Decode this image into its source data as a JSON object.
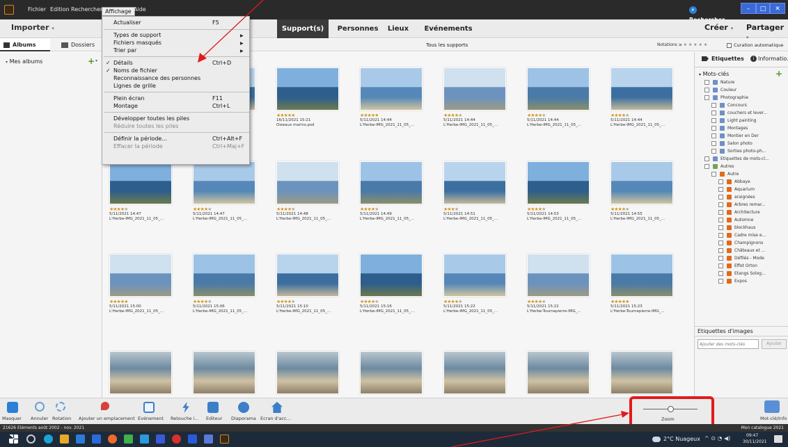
{
  "menubar": {
    "items": [
      "Fichier",
      "Edition",
      "Rechercher",
      "Affichage",
      "Aide"
    ],
    "search_label": "Rechercher",
    "window_buttons": [
      "–",
      "□",
      "✕"
    ]
  },
  "toolbar": {
    "import_label": "Importer",
    "tabs": [
      "Support(s)",
      "Personnes",
      "Lieux",
      "Evénements"
    ],
    "create_label": "Créer",
    "share_label": "Partager"
  },
  "subbar": {
    "albums_label": "Albums",
    "folders_label": "Dossiers",
    "title": "Tous les supports",
    "ratings_label": "Notations ≥",
    "auto_curation_label": "Curation automatique"
  },
  "sidebar": {
    "my_albums_label": "Mes albums"
  },
  "dropdown_menu": {
    "items": [
      {
        "label": "Actualiser",
        "shortcut": "F5"
      },
      {
        "label": "Types de support"
      },
      {
        "label": "Fichiers masqués"
      },
      {
        "label": "Trier par"
      },
      {
        "label": "Détails",
        "shortcut": "Ctrl+D"
      },
      {
        "label": "Noms de fichier"
      },
      {
        "label": "Reconnaissance des personnes"
      },
      {
        "label": "Lignes de grille"
      },
      {
        "label": "Plein écran",
        "shortcut": "F11"
      },
      {
        "label": "Montage",
        "shortcut": "Ctrl+L"
      },
      {
        "label": "Développer toutes les piles"
      },
      {
        "label": "Réduire toutes les piles"
      },
      {
        "label": "Définir la période...",
        "shortcut": "Ctrl+Alt+F"
      },
      {
        "label": "Effacer la période",
        "shortcut": "Ctrl+Maj+F"
      }
    ]
  },
  "grid": {
    "rows": [
      [
        {
          "date": "",
          "name": "",
          "stars": 0
        },
        {
          "date": "",
          "name": "",
          "stars": 0
        },
        {
          "date": "16/11/2021 15:21",
          "name": "Oiseaux marins.psd",
          "stars": 5
        },
        {
          "date": "5/11/2021 14:44",
          "name": "L'Herbe-IMG_2021_11_05_...",
          "stars": 5
        },
        {
          "date": "5/11/2021 14:44",
          "name": "L'Herbe-IMG_2021_11_05_...",
          "stars": 4
        },
        {
          "date": "5/11/2021 14:44",
          "name": "L'Herbe-IMG_2021_11_05_...",
          "stars": 4
        },
        {
          "date": "5/11/2021 14:44",
          "name": "L'Herbe-IMG_2021_11_05_...",
          "stars": 4
        }
      ],
      [
        {
          "date": "5/11/2021 14:47",
          "name": "L'Herbe-IMG_2021_11_05_...",
          "stars": 4
        },
        {
          "date": "5/11/2021 14:47",
          "name": "L'Herbe-IMG_2021_11_05_...",
          "stars": 4
        },
        {
          "date": "5/11/2021 14:48",
          "name": "L'Herbe-IMG_2021_11_05_...",
          "stars": 4
        },
        {
          "date": "5/11/2021 14:49",
          "name": "L'Herbe-IMG_2021_11_05_...",
          "stars": 4
        },
        {
          "date": "5/11/2021 14:51",
          "name": "L'Herbe-IMG_2021_11_05_...",
          "stars": 3
        },
        {
          "date": "5/11/2021 14:53",
          "name": "L'Herbe-IMG_2021_11_05_...",
          "stars": 4
        },
        {
          "date": "5/11/2021 14:55",
          "name": "L'Herbe-IMG_2021_11_05_...",
          "stars": 4
        }
      ],
      [
        {
          "date": "5/11/2021 15:00",
          "name": "L'Herbe-IMG_2021_11_05_...",
          "stars": 5
        },
        {
          "date": "5/11/2021 15:06",
          "name": "L'Herbe-IMG_2021_11_05_...",
          "stars": 4
        },
        {
          "date": "5/11/2021 15:10",
          "name": "L'Herbe-IMG_2021_11_05_...",
          "stars": 4
        },
        {
          "date": "5/11/2021 15:16",
          "name": "L'Herbe-IMG_2021_11_05_...",
          "stars": 4
        },
        {
          "date": "5/11/2021 15:22",
          "name": "L'Herbe-IMG_2021_11_05_...",
          "stars": 4
        },
        {
          "date": "5/11/2021 15:22",
          "name": "L'Herbe-Tournepierre-IMG_...",
          "stars": 4
        },
        {
          "date": "5/11/2021 15:23",
          "name": "L'Herbe-Tournepierre-IMG_...",
          "stars": 5
        }
      ]
    ]
  },
  "right_panel": {
    "tab_tags": "Etiquettes",
    "tab_info": "Informatio...",
    "section_keywords": "Mots-clés",
    "keywords": [
      {
        "label": "Nature",
        "color": "#6f8fc8",
        "indent": 0
      },
      {
        "label": "Couleur",
        "color": "#6f8fc8",
        "indent": 0
      },
      {
        "label": "Photographie",
        "color": "#6f8fc8",
        "indent": 0
      },
      {
        "label": "Concours",
        "color": "#6f8fc8",
        "indent": 1
      },
      {
        "label": "couchers et lever...",
        "color": "#6f8fc8",
        "indent": 1
      },
      {
        "label": "Light painting",
        "color": "#6f8fc8",
        "indent": 1
      },
      {
        "label": "Montages",
        "color": "#6f8fc8",
        "indent": 1
      },
      {
        "label": "Montier en Der",
        "color": "#6f8fc8",
        "indent": 1
      },
      {
        "label": "Salon photo",
        "color": "#6f8fc8",
        "indent": 1
      },
      {
        "label": "Sorties photo-ph...",
        "color": "#6f8fc8",
        "indent": 1
      },
      {
        "label": "Etiquettes de mots-cl...",
        "color": "#6f8fc8",
        "indent": 0
      },
      {
        "label": "Autres",
        "color": "#7aa05a",
        "indent": 0
      },
      {
        "label": "Autre",
        "color": "#e06a1c",
        "indent": 1
      },
      {
        "label": "Abbaye",
        "color": "#e06a1c",
        "indent": 2
      },
      {
        "label": "Aquarium",
        "color": "#e06a1c",
        "indent": 2
      },
      {
        "label": "araignées",
        "color": "#e06a1c",
        "indent": 2
      },
      {
        "label": "Arbres remar...",
        "color": "#e06a1c",
        "indent": 2
      },
      {
        "label": "Architecture",
        "color": "#e06a1c",
        "indent": 2
      },
      {
        "label": "Automne",
        "color": "#e06a1c",
        "indent": 2
      },
      {
        "label": "blockhaus",
        "color": "#e06a1c",
        "indent": 2
      },
      {
        "label": "Cadre mise e...",
        "color": "#e06a1c",
        "indent": 2
      },
      {
        "label": "Champignons",
        "color": "#e06a1c",
        "indent": 2
      },
      {
        "label": "Châteaux et ...",
        "color": "#e06a1c",
        "indent": 2
      },
      {
        "label": "Défilés - Mode",
        "color": "#e06a1c",
        "indent": 2
      },
      {
        "label": "Effet Orton",
        "color": "#e06a1c",
        "indent": 2
      },
      {
        "label": "Etangs Solog...",
        "color": "#e06a1c",
        "indent": 2
      },
      {
        "label": "Expos",
        "color": "#e06a1c",
        "indent": 2
      }
    ],
    "image_tags_label": "Etiquettes d'images",
    "add_keywords_placeholder": "Ajouter des mots-clés",
    "add_button": "Ajouter"
  },
  "bottombar": {
    "items": [
      "Masquer",
      "Annuler",
      "Rotation",
      "Ajouter un emplacement",
      "Evénement",
      "Retouche i...",
      "Editeur",
      "Diaporama",
      "Ecran d'acc..."
    ],
    "zoom_label": "Zoom",
    "zoom_level": 0.5,
    "keyword_info_label": "Mot-clé/Info"
  },
  "statusbar": {
    "left": "21626 Eléments   août 2002 - nov. 2021",
    "right": "Mon catalogue 2021"
  },
  "taskbar": {
    "weather": "2°C Nuageux",
    "time": "09:47",
    "date": "30/11/2021"
  }
}
